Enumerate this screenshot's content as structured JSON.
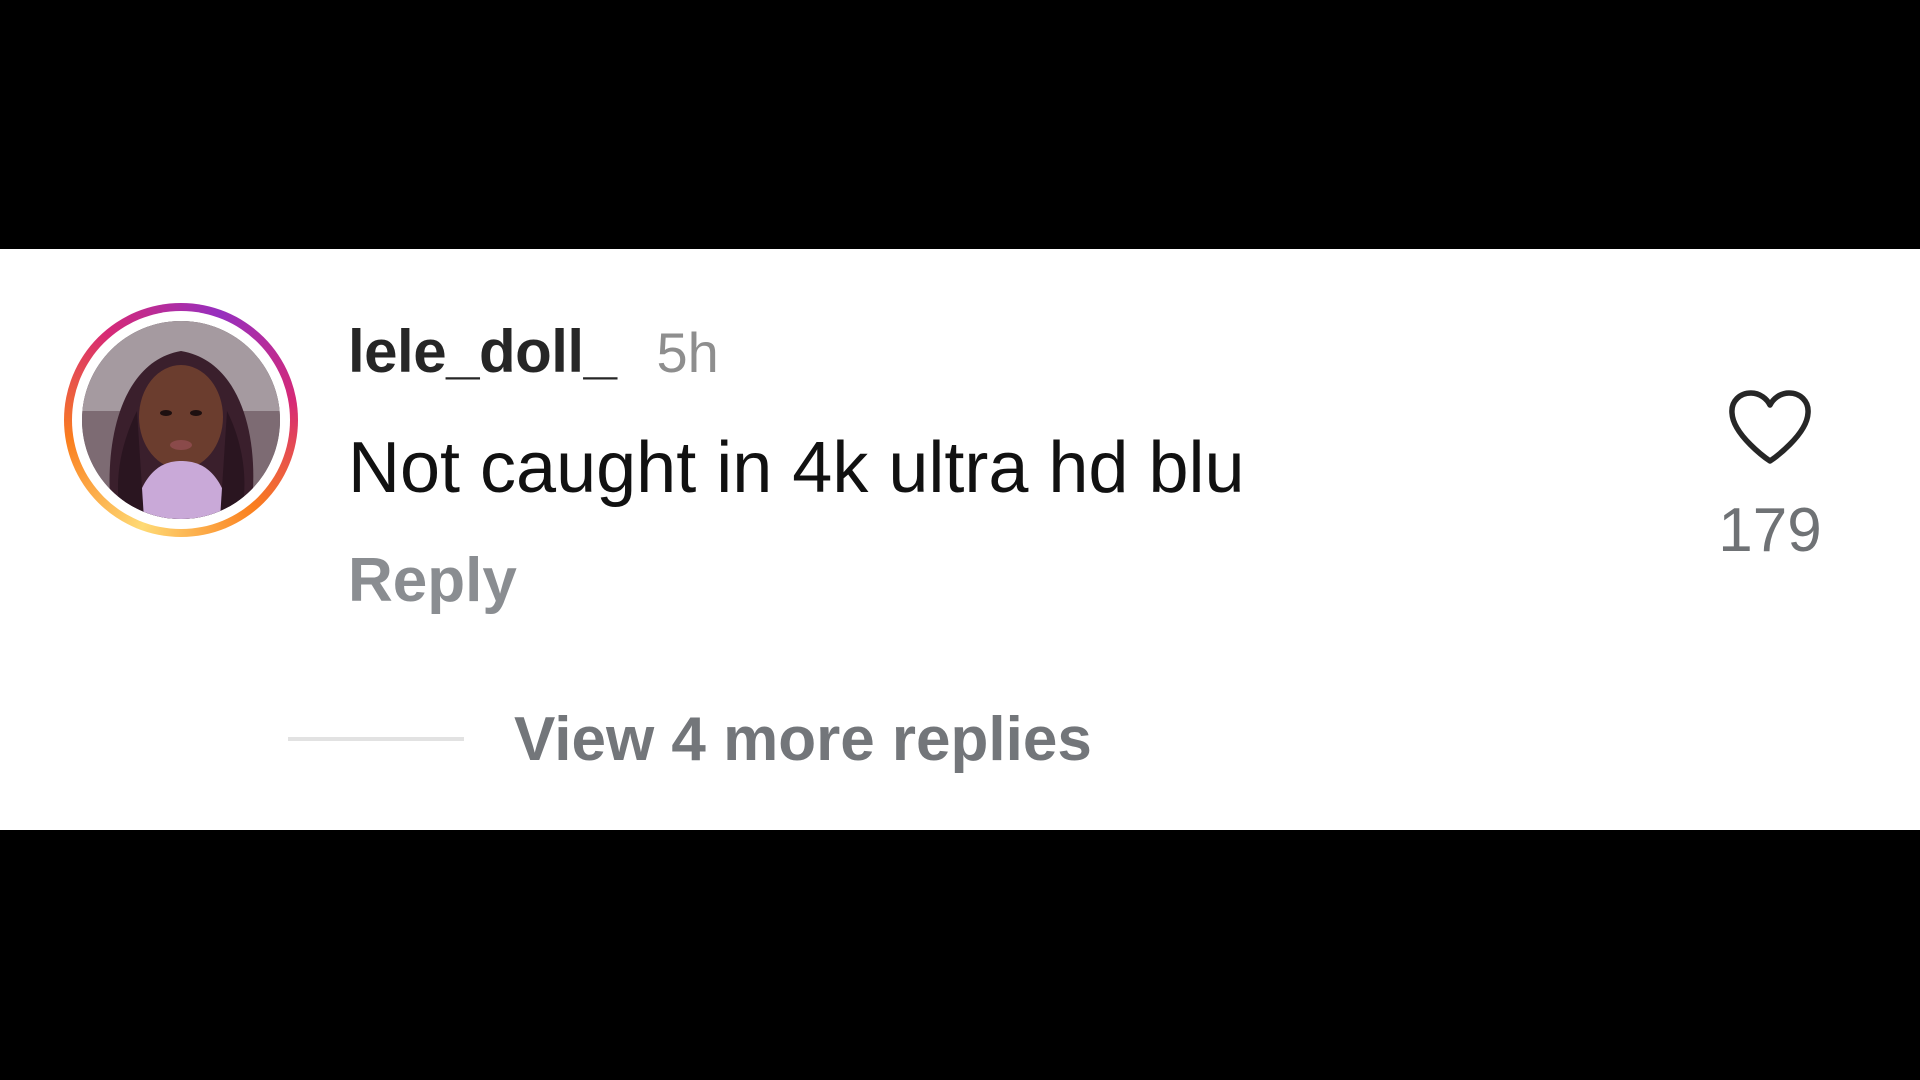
{
  "comment": {
    "username": "lele_doll_",
    "timestamp": "5h",
    "text": "Not caught in 4k ultra hd blu",
    "reply_label": "Reply",
    "like_count": "179",
    "view_replies_label": "View 4 more replies",
    "avatar_alt": "profile photo",
    "icons": {
      "like": "heart-outline-icon"
    },
    "colors": {
      "username": "#262626",
      "secondary_text": "#8e8e8e",
      "story_ring_start": "#feda75",
      "story_ring_end": "#962fbf"
    }
  }
}
